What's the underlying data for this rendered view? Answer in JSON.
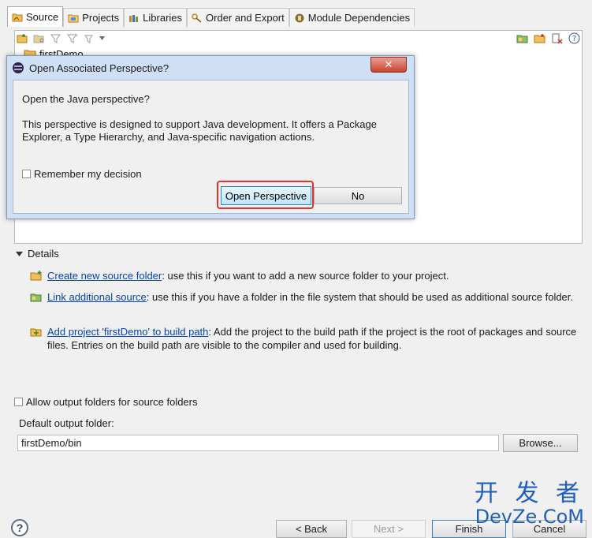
{
  "tabs": [
    {
      "label": "Source",
      "icon": "source-folder-icon",
      "active": true
    },
    {
      "label": "Projects",
      "icon": "projects-icon"
    },
    {
      "label": "Libraries",
      "icon": "libraries-icon"
    },
    {
      "label": "Order and Export",
      "icon": "order-export-icon"
    },
    {
      "label": "Module Dependencies",
      "icon": "module-icon"
    }
  ],
  "tree": {
    "project": "firstDemo"
  },
  "dialog": {
    "title": "Open Associated Perspective?",
    "close_label": "✕",
    "question": "Open the Java perspective?",
    "description": "This perspective is designed to support Java development. It offers a Package Explorer, a Type Hierarchy, and Java-specific navigation actions.",
    "remember_label": "Remember my decision",
    "open_button": "Open Perspective",
    "no_button": "No"
  },
  "details": {
    "header": "Details",
    "items": [
      {
        "link": "Create new source folder",
        "text": ": use this if you want to add a new source folder to your project."
      },
      {
        "link": "Link additional source",
        "text": ": use this if you have a folder in the file system that should be used as additional source folder."
      },
      {
        "link": "Add project 'firstDemo' to build path",
        "text": ": Add the project to the build path if the project is the root of packages and source files. Entries on the build path are visible to the compiler and used for building."
      }
    ]
  },
  "output": {
    "allow_label": "Allow output folders for source folders",
    "default_label": "Default output folder:",
    "default_value": "firstDemo/bin",
    "browse_button": "Browse..."
  },
  "footer": {
    "help": "?",
    "back": "< Back",
    "next": "Next >",
    "finish": "Finish",
    "cancel": "Cancel"
  },
  "watermark": {
    "line1": "开 发 者",
    "line2": "DevZe.CoM"
  },
  "colors": {
    "link": "#0645ad",
    "highlight": "#e0352b",
    "dialog_frame": "#cfe0f4"
  }
}
